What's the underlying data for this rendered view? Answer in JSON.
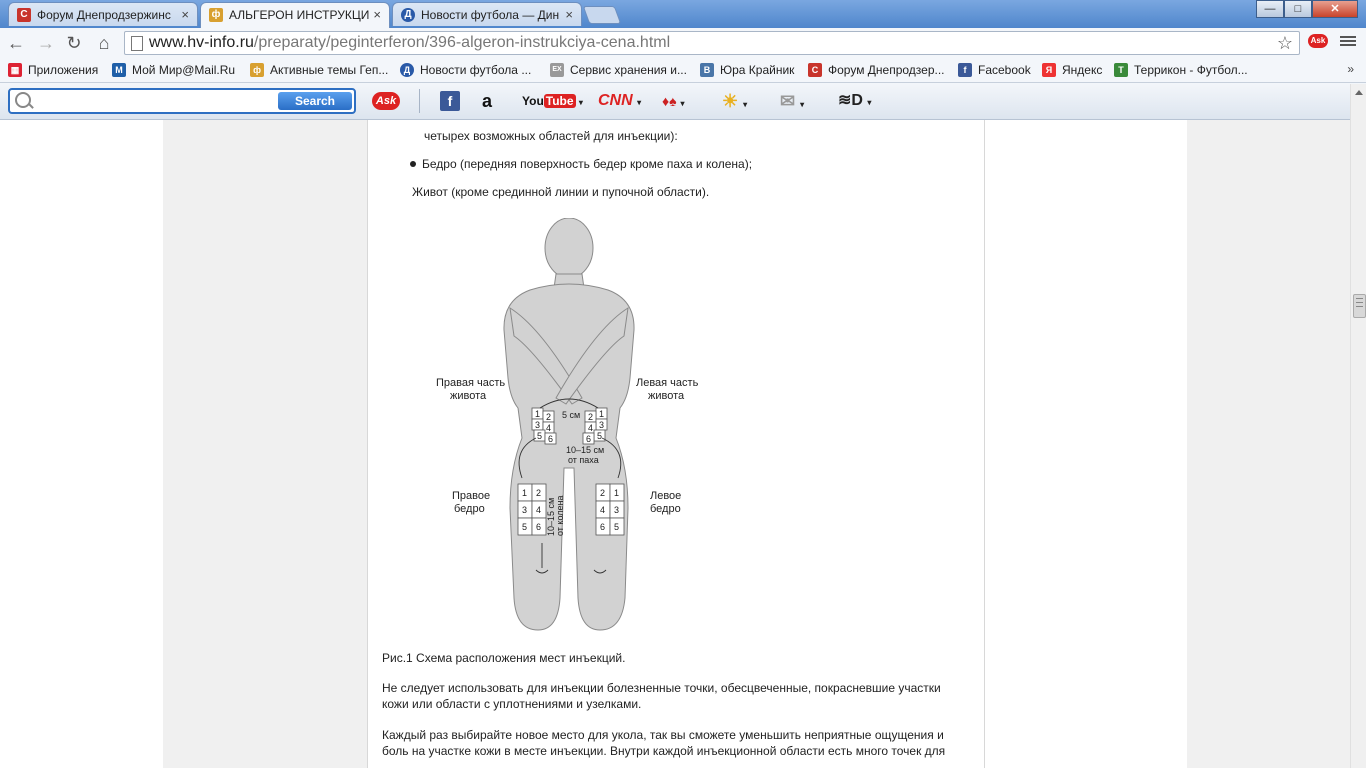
{
  "tabs": [
    {
      "title": "Форум Днепродзержинс",
      "icon": "C",
      "color": "#c8342b"
    },
    {
      "title": "АЛЬГЕРОН ИНСТРУКЦИ",
      "icon": "ф",
      "color": "#d8a030"
    },
    {
      "title": "Новости футбола — Дин",
      "icon": "Д",
      "color": "#2a5aa8"
    }
  ],
  "window": {
    "minimize": "—",
    "maximize": "□",
    "close": "✕"
  },
  "nav": {
    "back": "←",
    "forward": "→",
    "reload": "↻",
    "home": "⌂"
  },
  "address": {
    "host": "www.hv-info.ru",
    "path": "/preparaty/peginterferon/396-algeron-instrukciya-cena.html"
  },
  "bookmarks": [
    {
      "label": "Приложения",
      "icon": "▦",
      "color": "#d23"
    },
    {
      "label": "Мой Мир@Mail.Ru",
      "icon": "M",
      "color": "#1f5fa8"
    },
    {
      "label": "Активные темы Геп...",
      "icon": "ф",
      "color": "#d8a030"
    },
    {
      "label": "Новости футбола ...",
      "icon": "Д",
      "color": "#2a5aa8"
    },
    {
      "label": "Сервис хранения и...",
      "icon": "EX",
      "color": "#999"
    },
    {
      "label": "Юра Крайник",
      "icon": "B",
      "color": "#4a76a8"
    },
    {
      "label": "Форум Днепродзер...",
      "icon": "C",
      "color": "#c8342b"
    },
    {
      "label": "Facebook",
      "icon": "f",
      "color": "#3b5998"
    },
    {
      "label": "Яндекс",
      "icon": "Я",
      "color": "#e33"
    },
    {
      "label": "Террикон - Футбол...",
      "icon": "T",
      "color": "#3a8a3a"
    }
  ],
  "asktoolbar": {
    "search_placeholder": "",
    "search_button": "Search",
    "ask_logo": "Ask",
    "youtube": "YouTube",
    "cnn": "CNN"
  },
  "content": {
    "line_cut_2": "четырех возможных областей для инъекции):",
    "bullet_1": "Бедро (передняя поверхность бедер кроме паха и колена);",
    "abdomen": "Живот (кроме срединной линии и пупочной области).",
    "figure": {
      "right_abdomen_l1": "Правая часть",
      "right_abdomen_l2": "живота",
      "left_abdomen_l1": "Левая часть",
      "left_abdomen_l2": "живота",
      "right_thigh_l1": "Правое",
      "right_thigh_l2": "бедро",
      "left_thigh_l1": "Левое",
      "left_thigh_l2": "бедро",
      "five_cm": "5 см",
      "groin_l1": "10–15 см",
      "groin_l2": "от паха",
      "knee_l1": "10–15 см",
      "knee_l2": "от колена",
      "n1": "1",
      "n2": "2",
      "n3": "3",
      "n4": "4",
      "n5": "5",
      "n6": "6"
    },
    "caption": "Рис.1 Схема расположения мест инъекций.",
    "para1_l1": "Не следует использовать для инъекции болезненные точки, обесцвеченные, покрасневшие участки",
    "para1_l2": "кожи или области с уплотнениями и узелками.",
    "para2_l1": "Каждый раз выбирайте новое место для укола, так вы сможете уменьшить неприятные ощущения и",
    "para2_l2": "боль на участке кожи в месте инъекции. Внутри каждой инъекционной области есть много точек для"
  }
}
